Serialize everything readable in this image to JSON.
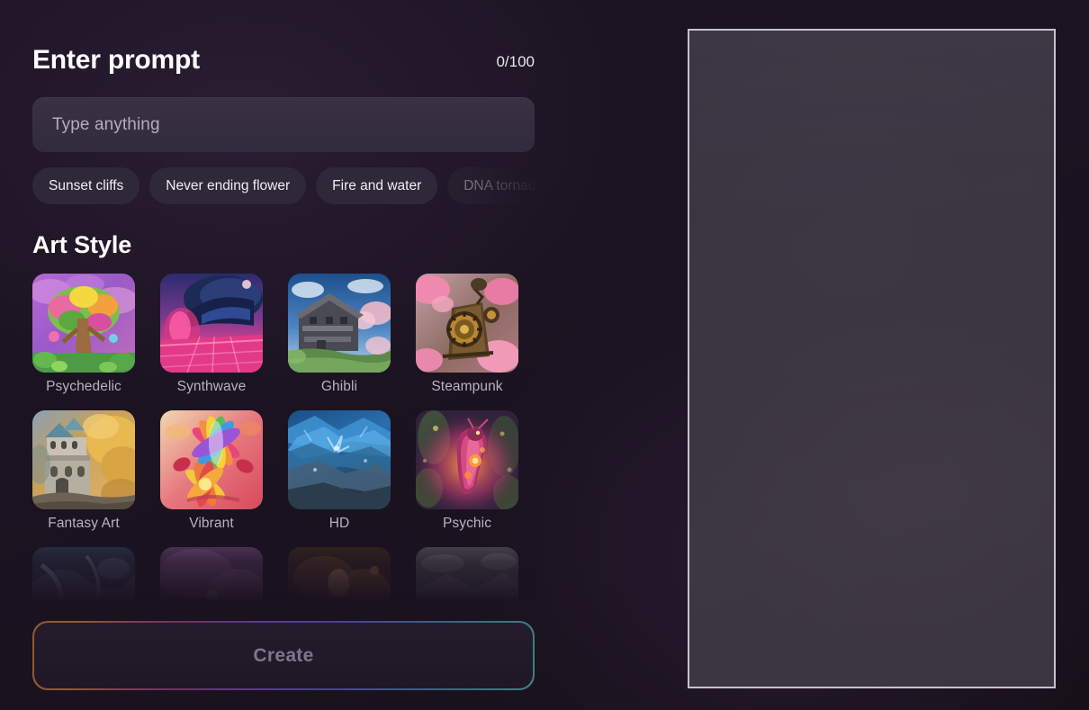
{
  "prompt": {
    "title": "Enter prompt",
    "counter": "0/100",
    "placeholder": "Type anything",
    "value": ""
  },
  "suggestions": [
    {
      "label": "Sunset cliffs",
      "faded": false
    },
    {
      "label": "Never ending flower",
      "faded": false
    },
    {
      "label": "Fire and water",
      "faded": false
    },
    {
      "label": "DNA tornado",
      "faded": true
    }
  ],
  "art_style": {
    "title": "Art Style",
    "items": [
      {
        "label": "Psychedelic",
        "thumb": "psychedelic-tree-thumbnail"
      },
      {
        "label": "Synthwave",
        "thumb": "synthwave-neon-thumbnail"
      },
      {
        "label": "Ghibli",
        "thumb": "ghibli-house-thumbnail"
      },
      {
        "label": "Steampunk",
        "thumb": "steampunk-gears-thumbnail"
      },
      {
        "label": "Fantasy Art",
        "thumb": "fantasy-castle-thumbnail"
      },
      {
        "label": "Vibrant",
        "thumb": "vibrant-flower-thumbnail"
      },
      {
        "label": "HD",
        "thumb": "hd-ice-thumbnail"
      },
      {
        "label": "Psychic",
        "thumb": "psychic-creature-thumbnail"
      },
      {
        "label": "",
        "thumb": "row3-blue-thumbnail"
      },
      {
        "label": "",
        "thumb": "row3-pink-thumbnail"
      },
      {
        "label": "",
        "thumb": "row3-amber-thumbnail"
      },
      {
        "label": "",
        "thumb": "row3-gray-thumbnail"
      }
    ]
  },
  "create": {
    "label": "Create",
    "enabled": false
  },
  "preview": {
    "content": "",
    "empty": true
  },
  "colors": {
    "background": "#1d1424",
    "input_bg": "#3a3243",
    "chip_bg": "#2f2838",
    "label_text": "#b9b2c3",
    "create_border_start": "#8a5a2e",
    "create_border_mid": "#5d3a86",
    "create_border_end": "#3f7f85",
    "create_text": "#7e7689",
    "preview_border": "#c6c2cc"
  }
}
